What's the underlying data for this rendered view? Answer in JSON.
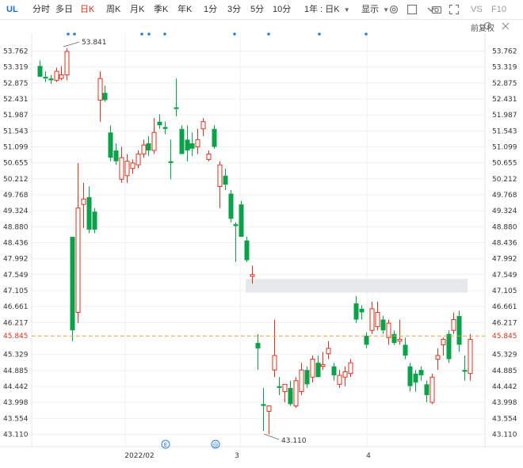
{
  "toolbar": {
    "symbol": "UL",
    "periods": [
      "分时",
      "多日",
      "日K",
      "周K",
      "月K",
      "季K",
      "年K",
      "1分",
      "3分",
      "5分",
      "10分"
    ],
    "active_period": "日K",
    "range_select": "1年 : 日K",
    "display_label": "显示",
    "vs_label": "VS",
    "f10_label": "F10"
  },
  "adjust_label": "前复权",
  "chart_data": {
    "type": "candlestick",
    "y_ticks": [
      53.762,
      53.319,
      52.875,
      52.431,
      51.987,
      51.543,
      51.099,
      50.655,
      50.212,
      49.768,
      49.324,
      48.88,
      48.436,
      47.992,
      47.549,
      47.105,
      46.661,
      46.217,
      45.329,
      44.885,
      44.442,
      43.998,
      43.554,
      43.11
    ],
    "ylim": [
      43.11,
      53.762
    ],
    "current_price": "45.845",
    "x_labels": [
      "2022/02",
      "3",
      "4"
    ],
    "high_annotation": "53.841",
    "low_annotation": "43.110",
    "up_color": "#e0301e",
    "down_color": "#0aa14b",
    "candles": [
      {
        "o": 53.35,
        "h": 53.5,
        "l": 53.05,
        "c": 53.05
      },
      {
        "o": 53.05,
        "h": 53.2,
        "l": 52.9,
        "c": 53.0
      },
      {
        "o": 53.0,
        "h": 53.1,
        "l": 52.85,
        "c": 52.95
      },
      {
        "o": 52.95,
        "h": 53.3,
        "l": 52.9,
        "c": 53.2
      },
      {
        "o": 53.0,
        "h": 53.35,
        "l": 52.95,
        "c": 53.1
      },
      {
        "o": 53.1,
        "h": 53.841,
        "l": 52.95,
        "c": 53.75
      },
      {
        "o": 48.6,
        "h": 48.6,
        "l": 45.7,
        "c": 46.0
      },
      {
        "o": 46.5,
        "h": 50.65,
        "l": 46.2,
        "c": 49.4
      },
      {
        "o": 49.5,
        "h": 50.1,
        "l": 48.85,
        "c": 49.65
      },
      {
        "o": 49.7,
        "h": 50.0,
        "l": 48.7,
        "c": 48.8
      },
      {
        "o": 49.3,
        "h": 49.4,
        "l": 48.7,
        "c": 48.8
      },
      {
        "o": 52.4,
        "h": 53.2,
        "l": 51.8,
        "c": 53.0
      },
      {
        "o": 52.6,
        "h": 52.8,
        "l": 52.35,
        "c": 52.4
      },
      {
        "o": 51.5,
        "h": 51.7,
        "l": 50.7,
        "c": 50.8
      },
      {
        "o": 51.0,
        "h": 51.2,
        "l": 50.6,
        "c": 50.7
      },
      {
        "o": 50.2,
        "h": 51.1,
        "l": 50.1,
        "c": 50.8
      },
      {
        "o": 50.3,
        "h": 50.9,
        "l": 50.1,
        "c": 50.7
      },
      {
        "o": 50.5,
        "h": 50.75,
        "l": 50.35,
        "c": 50.65
      },
      {
        "o": 50.6,
        "h": 51.0,
        "l": 50.5,
        "c": 50.9
      },
      {
        "o": 50.9,
        "h": 51.3,
        "l": 50.8,
        "c": 51.15
      },
      {
        "o": 51.2,
        "h": 51.4,
        "l": 50.85,
        "c": 51.0
      },
      {
        "o": 51.0,
        "h": 51.9,
        "l": 50.9,
        "c": 51.5
      },
      {
        "o": 51.8,
        "h": 52.0,
        "l": 51.6,
        "c": 51.7
      },
      {
        "o": 51.65,
        "h": 51.8,
        "l": 51.45,
        "c": 51.6
      },
      {
        "o": 50.7,
        "h": 51.3,
        "l": 50.2,
        "c": 50.65
      },
      {
        "o": 52.2,
        "h": 53.0,
        "l": 51.95,
        "c": 52.15
      },
      {
        "o": 51.6,
        "h": 51.7,
        "l": 50.9,
        "c": 50.9
      },
      {
        "o": 51.3,
        "h": 51.7,
        "l": 50.7,
        "c": 51.0
      },
      {
        "o": 51.2,
        "h": 51.5,
        "l": 50.85,
        "c": 51.05
      },
      {
        "o": 51.1,
        "h": 51.6,
        "l": 50.9,
        "c": 51.3
      },
      {
        "o": 51.6,
        "h": 51.9,
        "l": 51.4,
        "c": 51.8
      },
      {
        "o": 50.75,
        "h": 51.0,
        "l": 50.7,
        "c": 50.9
      },
      {
        "o": 51.6,
        "h": 51.7,
        "l": 51.05,
        "c": 51.1
      },
      {
        "o": 50.0,
        "h": 50.7,
        "l": 49.4,
        "c": 50.6
      },
      {
        "o": 50.3,
        "h": 50.5,
        "l": 49.9,
        "c": 50.05
      },
      {
        "o": 49.8,
        "h": 49.9,
        "l": 49.0,
        "c": 49.1
      },
      {
        "o": 48.95,
        "h": 49.0,
        "l": 47.9,
        "c": 48.9
      },
      {
        "o": 49.5,
        "h": 49.6,
        "l": 48.6,
        "c": 48.6
      },
      {
        "o": 48.5,
        "h": 48.6,
        "l": 47.9,
        "c": 47.95
      },
      {
        "o": 47.5,
        "h": 47.8,
        "l": 47.3,
        "c": 47.55
      },
      {
        "o": 45.65,
        "h": 45.9,
        "l": 44.9,
        "c": 45.5
      },
      {
        "o": 43.95,
        "h": 44.4,
        "l": 43.2,
        "c": 43.9
      },
      {
        "o": 43.75,
        "h": 43.9,
        "l": 43.11,
        "c": 43.9
      },
      {
        "o": 44.9,
        "h": 46.3,
        "l": 44.7,
        "c": 45.3
      },
      {
        "o": 44.45,
        "h": 44.7,
        "l": 44.2,
        "c": 44.4
      },
      {
        "o": 44.3,
        "h": 44.5,
        "l": 44.0,
        "c": 44.5
      },
      {
        "o": 44.4,
        "h": 44.6,
        "l": 43.9,
        "c": 43.95
      },
      {
        "o": 43.9,
        "h": 44.7,
        "l": 43.85,
        "c": 44.6
      },
      {
        "o": 44.3,
        "h": 45.1,
        "l": 44.2,
        "c": 44.9
      },
      {
        "o": 44.9,
        "h": 45.0,
        "l": 44.4,
        "c": 44.5
      },
      {
        "o": 44.7,
        "h": 45.3,
        "l": 44.55,
        "c": 45.2
      },
      {
        "o": 45.1,
        "h": 45.3,
        "l": 44.7,
        "c": 44.7
      },
      {
        "o": 45.0,
        "h": 45.4,
        "l": 44.9,
        "c": 45.05
      },
      {
        "o": 45.35,
        "h": 45.7,
        "l": 45.2,
        "c": 45.5
      },
      {
        "o": 45.0,
        "h": 45.1,
        "l": 44.6,
        "c": 44.75
      },
      {
        "o": 44.5,
        "h": 44.9,
        "l": 44.4,
        "c": 44.75
      },
      {
        "o": 44.7,
        "h": 45.0,
        "l": 44.45,
        "c": 44.85
      },
      {
        "o": 44.8,
        "h": 45.2,
        "l": 44.7,
        "c": 45.1
      },
      {
        "o": 46.75,
        "h": 46.95,
        "l": 46.2,
        "c": 46.3
      },
      {
        "o": 46.6,
        "h": 46.7,
        "l": 46.3,
        "c": 46.5
      },
      {
        "o": 45.85,
        "h": 45.95,
        "l": 45.5,
        "c": 45.6
      },
      {
        "o": 46.0,
        "h": 46.8,
        "l": 45.9,
        "c": 46.6
      },
      {
        "o": 46.1,
        "h": 46.8,
        "l": 46.0,
        "c": 46.5
      },
      {
        "o": 46.3,
        "h": 46.4,
        "l": 45.9,
        "c": 46.0
      },
      {
        "o": 45.8,
        "h": 46.3,
        "l": 45.6,
        "c": 46.2
      },
      {
        "o": 45.9,
        "h": 46.0,
        "l": 45.6,
        "c": 45.65
      },
      {
        "o": 45.7,
        "h": 46.3,
        "l": 45.6,
        "c": 45.75
      },
      {
        "o": 45.6,
        "h": 45.8,
        "l": 45.2,
        "c": 45.3
      },
      {
        "o": 45.0,
        "h": 45.1,
        "l": 44.3,
        "c": 44.45
      },
      {
        "o": 44.8,
        "h": 44.9,
        "l": 44.3,
        "c": 44.55
      },
      {
        "o": 44.9,
        "h": 45.0,
        "l": 44.6,
        "c": 44.75
      },
      {
        "o": 44.5,
        "h": 44.6,
        "l": 44.0,
        "c": 44.2
      },
      {
        "o": 44.0,
        "h": 44.8,
        "l": 43.95,
        "c": 44.7
      },
      {
        "o": 45.2,
        "h": 45.5,
        "l": 44.9,
        "c": 45.3
      },
      {
        "o": 45.6,
        "h": 45.8,
        "l": 45.3,
        "c": 45.75
      },
      {
        "o": 45.9,
        "h": 46.0,
        "l": 45.1,
        "c": 45.2
      },
      {
        "o": 46.0,
        "h": 46.5,
        "l": 45.9,
        "c": 46.3
      },
      {
        "o": 46.4,
        "h": 46.55,
        "l": 45.4,
        "c": 45.6
      },
      {
        "o": 44.9,
        "h": 45.3,
        "l": 44.6,
        "c": 44.85
      },
      {
        "o": 44.8,
        "h": 45.9,
        "l": 44.6,
        "c": 45.75
      }
    ]
  }
}
